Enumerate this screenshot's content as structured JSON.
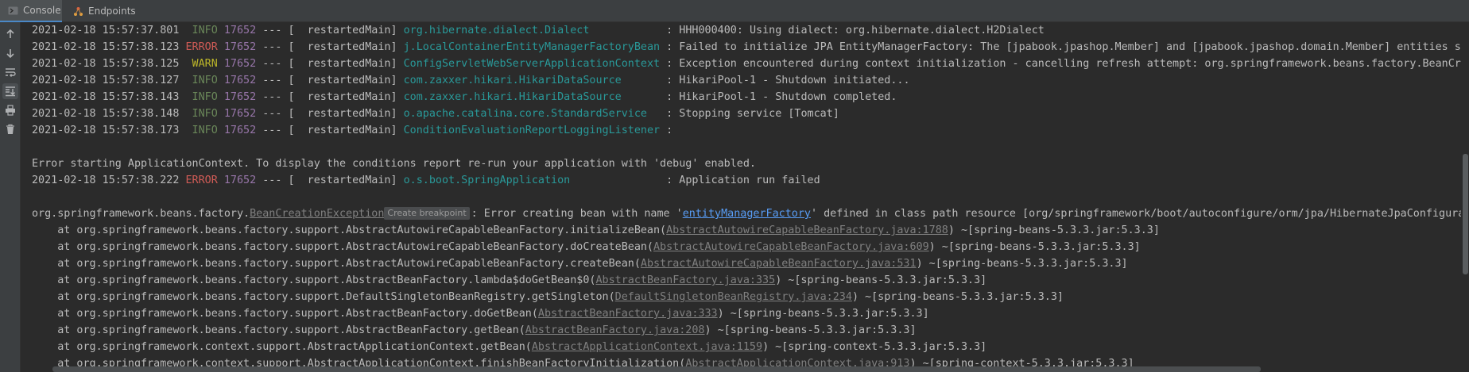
{
  "tabs": {
    "console": "Console",
    "endpoints": "Endpoints"
  },
  "toolbar": {
    "up_icon": "arrow-up-icon",
    "down_icon": "arrow-down-icon",
    "wrap_icon": "soft-wrap-icon",
    "scroll_end_icon": "scroll-to-end-icon",
    "print_icon": "print-icon",
    "clear_icon": "trash-icon"
  },
  "log": {
    "lines": [
      {
        "ts": "2021-02-18 15:57:37.801",
        "level": " INFO",
        "pid": "17652",
        "thread": " --- [  restartedMain] ",
        "logger": "org.hibernate.dialect.Dialect",
        "pad": "            ",
        "msg": ": HHH000400: Using dialect: org.hibernate.dialect.H2Dialect"
      },
      {
        "ts": "2021-02-18 15:57:38.123",
        "level": "ERROR",
        "pid": "17652",
        "thread": " --- [  restartedMain] ",
        "logger": "j.LocalContainerEntityManagerFactoryBean",
        "pad": " ",
        "msg": ": Failed to initialize JPA EntityManagerFactory: The [jpabook.jpashop.Member] and [jpabook.jpashop.domain.Member] entities shar"
      },
      {
        "ts": "2021-02-18 15:57:38.125",
        "level": " WARN",
        "pid": "17652",
        "thread": " --- [  restartedMain] ",
        "logger": "ConfigServletWebServerApplicationContext",
        "pad": " ",
        "msg": ": Exception encountered during context initialization - cancelling refresh attempt: org.springframework.beans.factory.BeanCreat"
      },
      {
        "ts": "2021-02-18 15:57:38.127",
        "level": " INFO",
        "pid": "17652",
        "thread": " --- [  restartedMain] ",
        "logger": "com.zaxxer.hikari.HikariDataSource",
        "pad": "       ",
        "msg": ": HikariPool-1 - Shutdown initiated..."
      },
      {
        "ts": "2021-02-18 15:57:38.143",
        "level": " INFO",
        "pid": "17652",
        "thread": " --- [  restartedMain] ",
        "logger": "com.zaxxer.hikari.HikariDataSource",
        "pad": "       ",
        "msg": ": HikariPool-1 - Shutdown completed."
      },
      {
        "ts": "2021-02-18 15:57:38.148",
        "level": " INFO",
        "pid": "17652",
        "thread": " --- [  restartedMain] ",
        "logger": "o.apache.catalina.core.StandardService",
        "pad": "   ",
        "msg": ": Stopping service [Tomcat]"
      },
      {
        "ts": "2021-02-18 15:57:38.173",
        "level": " INFO",
        "pid": "17652",
        "thread": " --- [  restartedMain] ",
        "logger": "ConditionEvaluationReportLoggingListener",
        "pad": " ",
        "msg": ":"
      }
    ],
    "context_error": "Error starting ApplicationContext. To display the conditions report re-run your application with 'debug' enabled.",
    "failed_line": {
      "ts": "2021-02-18 15:57:38.222",
      "level": "ERROR",
      "pid": "17652",
      "thread": " --- [  restartedMain] ",
      "logger": "o.s.boot.SpringApplication",
      "pad": "               ",
      "msg": ": Application run failed"
    },
    "exception": {
      "prefix": "org.springframework.beans.factory.",
      "class_name": "BeanCreationException",
      "breakpoint_chip": "Create breakpoint",
      "msg_a": ": Error creating bean with name '",
      "bean_name": "entityManagerFactory",
      "msg_b": "' defined in class path resource [org/springframework/boot/autoconfigure/orm/jpa/HibernateJpaConfiguratio"
    },
    "stack": [
      {
        "at": "    at org.springframework.beans.factory.support.AbstractAutowireCapableBeanFactory.initializeBean(",
        "file": "AbstractAutowireCapableBeanFactory.java:1788",
        "tail": ") ~[spring-beans-5.3.3.jar:5.3.3]"
      },
      {
        "at": "    at org.springframework.beans.factory.support.AbstractAutowireCapableBeanFactory.doCreateBean(",
        "file": "AbstractAutowireCapableBeanFactory.java:609",
        "tail": ") ~[spring-beans-5.3.3.jar:5.3.3]"
      },
      {
        "at": "    at org.springframework.beans.factory.support.AbstractAutowireCapableBeanFactory.createBean(",
        "file": "AbstractAutowireCapableBeanFactory.java:531",
        "tail": ") ~[spring-beans-5.3.3.jar:5.3.3]"
      },
      {
        "at": "    at org.springframework.beans.factory.support.AbstractBeanFactory.lambda$doGetBean$0(",
        "file": "AbstractBeanFactory.java:335",
        "tail": ") ~[spring-beans-5.3.3.jar:5.3.3]"
      },
      {
        "at": "    at org.springframework.beans.factory.support.DefaultSingletonBeanRegistry.getSingleton(",
        "file": "DefaultSingletonBeanRegistry.java:234",
        "tail": ") ~[spring-beans-5.3.3.jar:5.3.3]"
      },
      {
        "at": "    at org.springframework.beans.factory.support.AbstractBeanFactory.doGetBean(",
        "file": "AbstractBeanFactory.java:333",
        "tail": ") ~[spring-beans-5.3.3.jar:5.3.3]"
      },
      {
        "at": "    at org.springframework.beans.factory.support.AbstractBeanFactory.getBean(",
        "file": "AbstractBeanFactory.java:208",
        "tail": ") ~[spring-beans-5.3.3.jar:5.3.3]"
      },
      {
        "at": "    at org.springframework.context.support.AbstractApplicationContext.getBean(",
        "file": "AbstractApplicationContext.java:1159",
        "tail": ") ~[spring-context-5.3.3.jar:5.3.3]"
      },
      {
        "at": "    at org.springframework.context.support.AbstractApplicationContext.finishBeanFactoryInitialization(",
        "file": "AbstractApplicationContext.java:913",
        "tail": ") ~[spring-context-5.3.3.jar:5.3.3]"
      }
    ]
  },
  "colors": {
    "background": "#2b2b2b",
    "info": "#6a8759",
    "warn": "#bbb529",
    "error": "#cf5b56",
    "pid": "#9876aa",
    "logger": "#299999",
    "link": "#589df6"
  }
}
